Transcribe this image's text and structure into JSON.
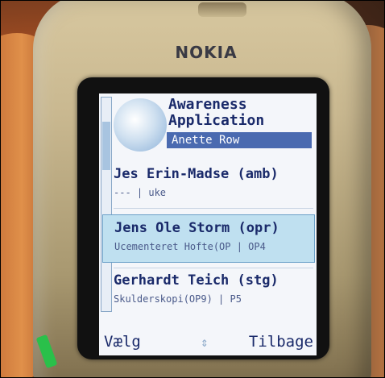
{
  "phone": {
    "brand": "NOKIA"
  },
  "app": {
    "title_line1": "Awareness",
    "title_line2": "Application",
    "user": "Anette Row"
  },
  "entries": [
    {
      "name": "Jes Erin-Madse (amb)",
      "detail": "--- | uke"
    },
    {
      "name": "Jens Ole Storm (opr)",
      "detail": "Ucementeret Hofte(OP | OP4"
    },
    {
      "name": "Gerhardt Teich (stg)",
      "detail": "Skulderskopi(OP9) | P5"
    }
  ],
  "softkeys": {
    "left": "Vælg",
    "nav": "⇕",
    "right": "Tilbage"
  }
}
